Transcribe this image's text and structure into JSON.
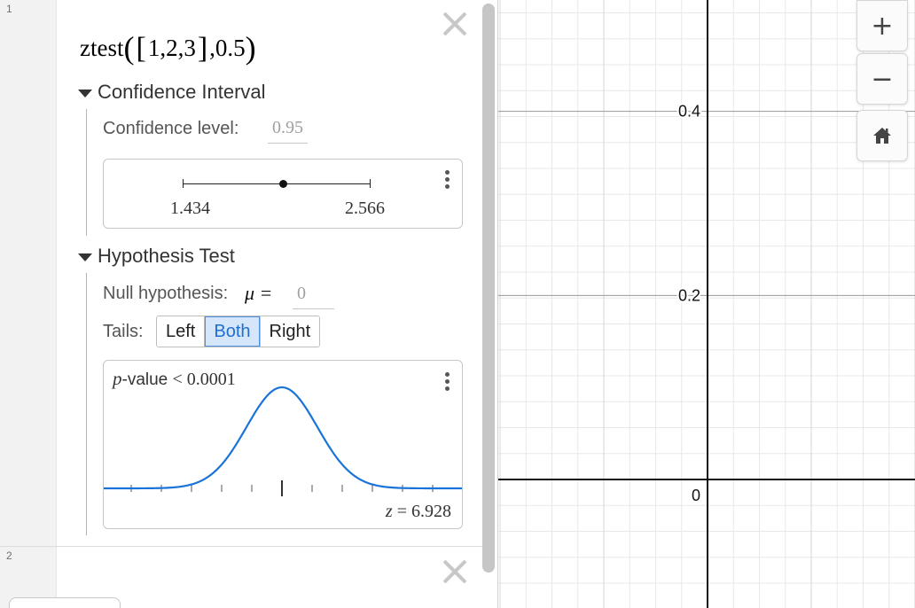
{
  "expressions": [
    {
      "number": "1",
      "latex": {
        "fn": "ztest",
        "list_items": "1,2,3",
        "arg": ",0.5"
      },
      "confidence_interval": {
        "heading": "Confidence Interval",
        "level_label": "Confidence level:",
        "level_value": "0.95",
        "lower": "1.434",
        "upper": "2.566"
      },
      "hypothesis_test": {
        "heading": "Hypothesis Test",
        "null_label": "Null hypothesis:",
        "mu_symbol": "μ =",
        "null_value": "0",
        "tails_label": "Tails:",
        "tails": [
          {
            "label": "Left",
            "active": false
          },
          {
            "label": "Both",
            "active": true
          },
          {
            "label": "Right",
            "active": false
          }
        ],
        "pvalue_p": "p",
        "pvalue_text": "-value",
        "pvalue_relation": "< 0.0001",
        "z_symbol": "z",
        "z_value": "= 6.928"
      }
    },
    {
      "number": "2"
    }
  ],
  "graph": {
    "y_ticks": [
      {
        "value": 0.4,
        "label": "0.4"
      },
      {
        "value": 0.2,
        "label": "0.2"
      },
      {
        "value": 0,
        "label": "0"
      }
    ]
  },
  "controls": {
    "zoom_in": "+",
    "zoom_out": "−"
  },
  "colors": {
    "curve": "#1a73d8",
    "active_tab_bg": "#d5e6fb",
    "active_tab_text": "#1e6fd1"
  }
}
